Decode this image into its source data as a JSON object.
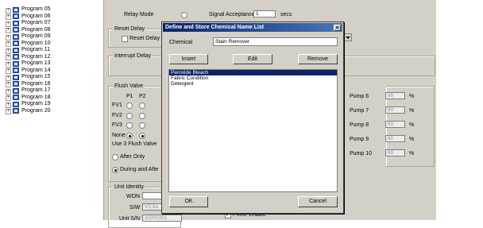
{
  "tree": {
    "items": [
      {
        "label": "Program 05"
      },
      {
        "label": "Program 06"
      },
      {
        "label": "Program 07"
      },
      {
        "label": "Program 08"
      },
      {
        "label": "Program 09"
      },
      {
        "label": "Program 10"
      },
      {
        "label": "Program 11"
      },
      {
        "label": "Program 12"
      },
      {
        "label": "Program 13"
      },
      {
        "label": "Program 14"
      },
      {
        "label": "Program 15"
      },
      {
        "label": "Program 16"
      },
      {
        "label": "Program 17"
      },
      {
        "label": "Program 18"
      },
      {
        "label": "Program 19"
      },
      {
        "label": "Program 20"
      }
    ],
    "expander_glyph": "+"
  },
  "panel": {
    "relay_mode_label": "Relay Mode",
    "signal_acceptance_label": "Signal Acceptance",
    "signal_acceptance_value": "1",
    "secs_label": "secs",
    "reset_delay_title": "Reset Delay",
    "reset_delay_check_label": "Reset Delay",
    "interrupt_delay_title": "Interrupt Delay",
    "flush_valve_title": "Flush Valve",
    "col_p1": "P1",
    "col_p2": "P2",
    "row_fv1": "FV1",
    "row_fv2": "FV2",
    "row_fv3": "FV3",
    "row_none": "None",
    "use3_label": "Use 3 Flush Valve",
    "after_only_label": "After Only",
    "during_after_label": "During and Afte",
    "unit_identity_title": "Unit Identity",
    "won_label": "WON",
    "sw_label": "S/W",
    "sw_value": "V2.9a",
    "unit_sn_label": "Unit S/N",
    "unit_sn_value": "11001001",
    "prime_enable_label": "Prime Enable",
    "pct": "%",
    "pumps": [
      {
        "label": "Pump 6",
        "value": "80"
      },
      {
        "label": "Pump 7",
        "value": "80"
      },
      {
        "label": "Pump 8",
        "value": "80"
      },
      {
        "label": "Pump 9",
        "value": "80"
      },
      {
        "label": "Pump 10",
        "value": "80"
      }
    ]
  },
  "dialog": {
    "title": "Define and Store Chemical Name List",
    "close_glyph": "×",
    "chemical_label": "Chemical",
    "chemical_value": "Stain Remover",
    "insert_label": "Insert",
    "edit_label": "Edit",
    "remove_label": "Remove",
    "list": [
      "Peroxide Bleach",
      "Fabric Condition",
      "Detergent"
    ],
    "selected_index": 0,
    "ok_label": "OK",
    "cancel_label": "Cancel"
  }
}
